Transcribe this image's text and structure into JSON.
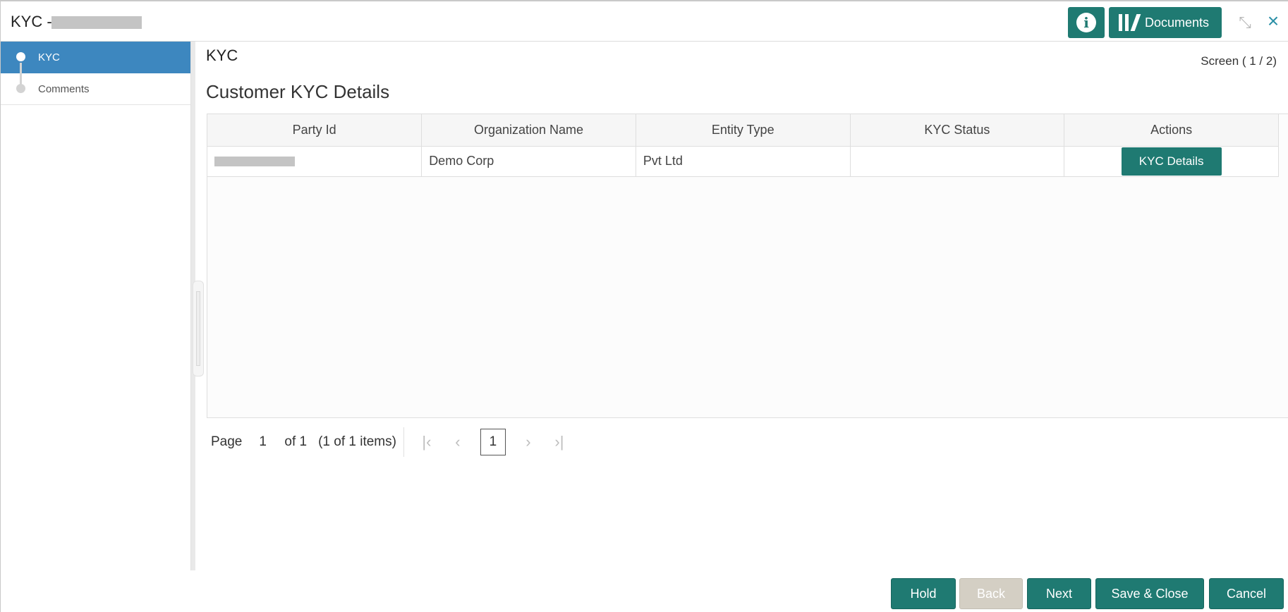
{
  "header": {
    "title": "KYC -",
    "info_icon_glyph": "i",
    "documents_label": "Documents"
  },
  "sidebar": {
    "items": [
      {
        "label": "KYC",
        "active": true
      },
      {
        "label": "Comments",
        "active": false
      }
    ]
  },
  "main": {
    "title": "KYC",
    "screen_indicator": "Screen ( 1 / 2)",
    "section_title": "Customer KYC Details"
  },
  "table": {
    "columns": [
      "Party Id",
      "Organization Name",
      "Entity Type",
      "KYC Status",
      "Actions"
    ],
    "rows": [
      {
        "party_id": "",
        "organization_name": "Demo Corp",
        "entity_type": "Pvt Ltd",
        "kyc_status": "",
        "action_label": "KYC Details"
      }
    ]
  },
  "pager": {
    "page_label": "Page",
    "page_value": "1",
    "of_label": "of 1",
    "items_label": "(1 of 1 items)",
    "current_page": "1"
  },
  "footer": {
    "hold": "Hold",
    "back": "Back",
    "next": "Next",
    "save_close": "Save & Close",
    "cancel": "Cancel"
  },
  "colors": {
    "primary": "#1f7a72",
    "sidebar_active": "#3d87bf",
    "close_icon": "#2a8fa6",
    "disabled": "#d4cfc4"
  }
}
